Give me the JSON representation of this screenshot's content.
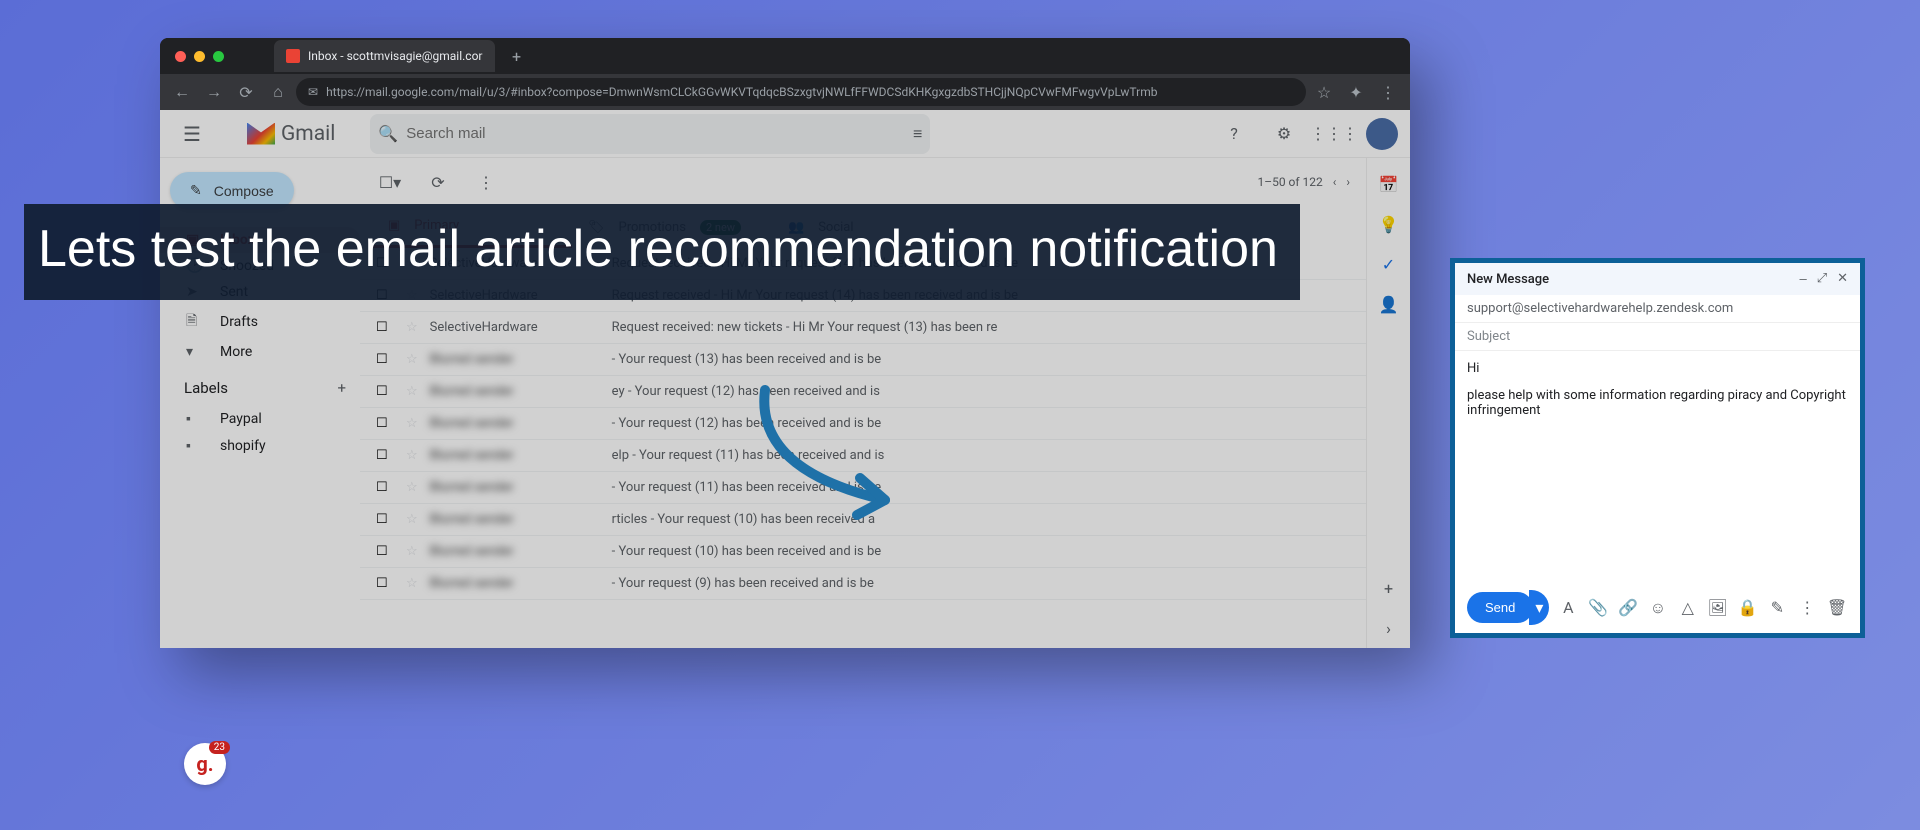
{
  "browser": {
    "tab_title": "Inbox - scottmvisagie@gmail.cor",
    "url": "https://mail.google.com/mail/u/3/#inbox?compose=DmwnWsmCLCkGGvWKVTqdqcBSzxgtvjNWLfFFWDCSdKHKgxgzdbSTHCjjNQpCVwFMFwgvVpLwTrmb"
  },
  "gmail": {
    "logo_text": "Gmail",
    "search_placeholder": "Search mail",
    "compose_label": "Compose",
    "sidebar": [
      {
        "label": "Inbox",
        "icon": "📥"
      },
      {
        "label": "Snoozed",
        "icon": "🕑"
      },
      {
        "label": "Sent",
        "icon": "➤"
      },
      {
        "label": "Drafts",
        "icon": "🗎"
      },
      {
        "label": "More",
        "icon": "▾"
      }
    ],
    "labels_header": "Labels",
    "labels": [
      "Paypal",
      "shopify"
    ],
    "pagination": "1–50 of 122",
    "tabs": {
      "primary": "Primary",
      "promotions": "Promotions",
      "promotions_badge": "2 new",
      "social": "Social"
    },
    "emails": [
      {
        "sender": "SelectiveHardware",
        "subject": "Request received - Hi Mr Your request (14) has been received and is be"
      },
      {
        "sender": "SelectiveHardware",
        "subject": "Request received - Hi Mr Your request (14) has been received and is be"
      },
      {
        "sender": "SelectiveHardware",
        "subject": "Request received: new tickets - Hi Mr Your request (13) has been re"
      },
      {
        "sender": "",
        "subject": "- Your request (13) has been received and is be"
      },
      {
        "sender": "",
        "subject": "ey - Your request (12) has been received and is"
      },
      {
        "sender": "",
        "subject": "- Your request (12) has been received and is be"
      },
      {
        "sender": "",
        "subject": "elp - Your request (11) has been received and is"
      },
      {
        "sender": "",
        "subject": "- Your request (11) has been received and is be"
      },
      {
        "sender": "",
        "subject": "rticles - Your request (10) has been received a"
      },
      {
        "sender": "",
        "subject": "- Your request (10) has been received and is be"
      },
      {
        "sender": "",
        "subject": "- Your request (9) has been received and is be"
      }
    ]
  },
  "compose": {
    "title": "New Message",
    "to": "support@selectivehardwarehelp.zendesk.com",
    "subject_placeholder": "Subject",
    "body_line1": "Hi",
    "body_line2": "please help with some information regarding piracy and Copyright infringement",
    "send_label": "Send"
  },
  "overlay": {
    "headline": "Lets test the email article recommendation notification"
  },
  "loom_count": "23"
}
